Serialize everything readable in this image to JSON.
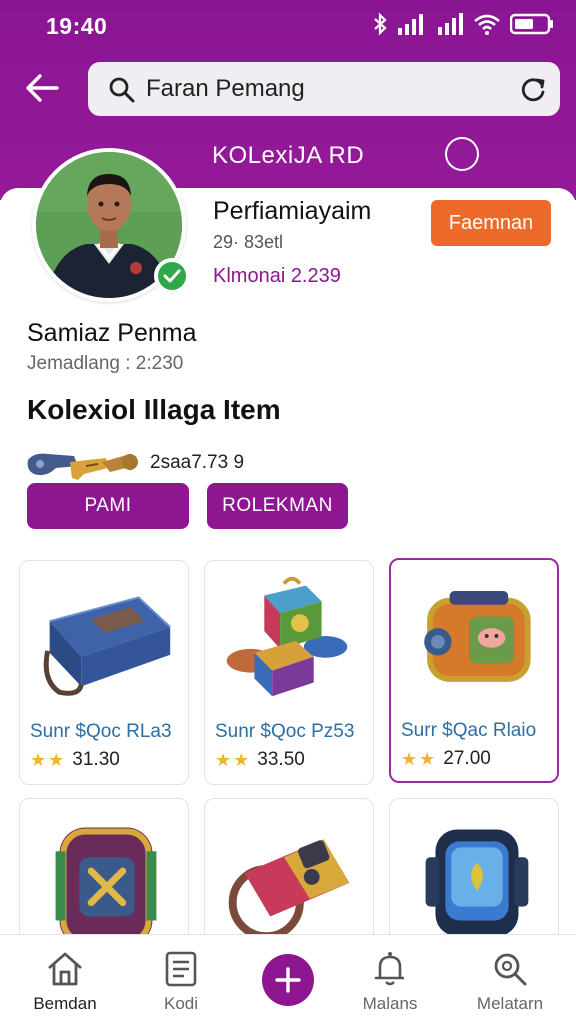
{
  "status_bar": {
    "time": "19:40"
  },
  "header": {
    "search_value": "Faran Pemang",
    "section_title": "KOLexiJA RD"
  },
  "profile": {
    "name": "Perfiamiayaim",
    "sub": "29· 83etl",
    "count": "Klmonai 2.239",
    "follow_label": "Faemnan"
  },
  "user": {
    "name": "Samiaz Penma",
    "meta": "Jemadlang : 2:230"
  },
  "collection": {
    "title": "Kolexiol Illaga Item",
    "value": "2saa7.73 9",
    "buttons": [
      "PAMI",
      "ROLEKMAN"
    ]
  },
  "items": [
    {
      "name": "Sunr $Qoc RLa3",
      "stars": 2,
      "price": "31.30",
      "icon": "blue-case-icon"
    },
    {
      "name": "Sunr $Qoc Pz53",
      "stars": 2,
      "price": "33.50",
      "icon": "cube-boxes-icon"
    },
    {
      "name": "Surr $Qac Rlaio",
      "stars": 2,
      "price": "27.00",
      "icon": "treasure-chest-icon",
      "selected": true
    },
    {
      "name": "",
      "stars": 0,
      "price": "",
      "icon": "wrist-band-icon"
    },
    {
      "name": "",
      "stars": 0,
      "price": "",
      "icon": "bracelet-icon"
    },
    {
      "name": "",
      "stars": 0,
      "price": "",
      "icon": "watch-device-icon"
    }
  ],
  "nav": {
    "items": [
      {
        "label": "Bemdan",
        "icon": "home-icon"
      },
      {
        "label": "Kodi",
        "icon": "document-icon"
      },
      {
        "label": "Malans",
        "icon": "bell-icon"
      },
      {
        "label": "Melatarn",
        "icon": "search-icon"
      }
    ]
  },
  "colors": {
    "brand": "#8e1791",
    "accent": "#ee6a2a",
    "verified": "#2ea84a",
    "item_name": "#2c6fa4",
    "star": "#f1b52b"
  }
}
